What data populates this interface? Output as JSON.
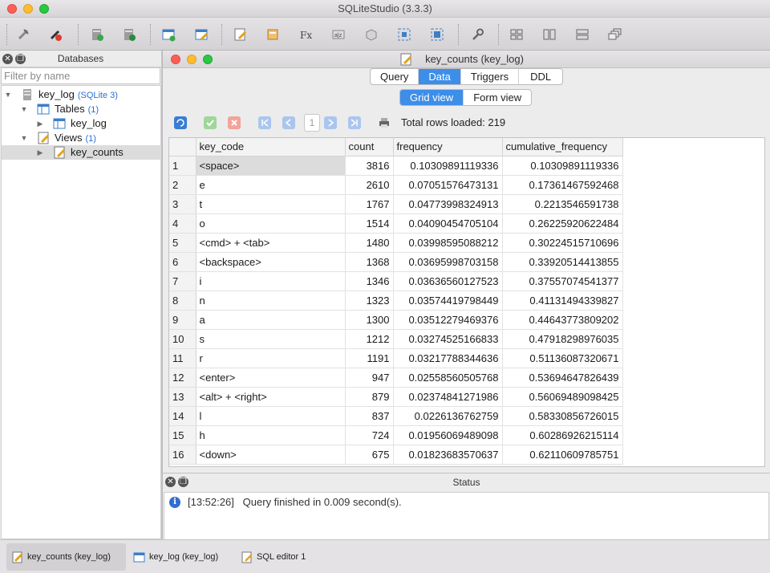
{
  "app": {
    "title": "SQLiteStudio (3.3.3)"
  },
  "toolbar": {
    "buttons": [
      "connect-db",
      "disconnect-db",
      "add-db",
      "edit-db",
      "add-table",
      "edit-table",
      "add-view",
      "add-index",
      "functions",
      "collations",
      "extensions",
      "sql-editor-tiled",
      "sql-editor-cascade",
      "open-sql-editor",
      "config",
      "tile",
      "tile-horizontal",
      "tile-vertical",
      "cascade"
    ]
  },
  "databases_panel": {
    "title": "Databases",
    "filter_placeholder": "Filter by name",
    "tree": {
      "db_name": "key_log",
      "db_type": "(SQLite 3)",
      "tables_label": "Tables",
      "tables_count": "(1)",
      "table_item": "key_log",
      "views_label": "Views",
      "views_count": "(1)",
      "view_item": "key_counts"
    }
  },
  "editor_window": {
    "title": "key_counts (key_log)",
    "tabs": [
      "Query",
      "Data",
      "Triggers",
      "DDL"
    ],
    "active_tab": "Data",
    "view_modes": [
      "Grid view",
      "Form view"
    ],
    "active_view_mode": "Grid view",
    "page": "1",
    "total_rows": "Total rows loaded: 219"
  },
  "grid": {
    "columns": [
      "key_code",
      "count",
      "frequency",
      "cumulative_frequency"
    ],
    "rows": [
      [
        "1",
        "<space>",
        "3816",
        "0.10309891119336",
        "0.10309891119336"
      ],
      [
        "2",
        "e",
        "2610",
        "0.07051576473131",
        "0.17361467592468"
      ],
      [
        "3",
        "t",
        "1767",
        "0.04773998324913",
        "0.2213546591738"
      ],
      [
        "4",
        "o",
        "1514",
        "0.04090454705104",
        "0.26225920622484"
      ],
      [
        "5",
        "<cmd> + <tab>",
        "1480",
        "0.03998595088212",
        "0.30224515710696"
      ],
      [
        "6",
        "<backspace>",
        "1368",
        "0.03695998703158",
        "0.33920514413855"
      ],
      [
        "7",
        "i",
        "1346",
        "0.03636560127523",
        "0.37557074541377"
      ],
      [
        "8",
        "n",
        "1323",
        "0.03574419798449",
        "0.41131494339827"
      ],
      [
        "9",
        "a",
        "1300",
        "0.03512279469376",
        "0.44643773809202"
      ],
      [
        "10",
        "s",
        "1212",
        "0.03274525166833",
        "0.47918298976035"
      ],
      [
        "11",
        "r",
        "1191",
        "0.03217788344636",
        "0.51136087320671"
      ],
      [
        "12",
        "<enter>",
        "947",
        "0.02558560505768",
        "0.53694647826439"
      ],
      [
        "13",
        "<alt> + <right>",
        "879",
        "0.02374841271986",
        "0.56069489098425"
      ],
      [
        "14",
        "l",
        "837",
        "0.0226136762759",
        "0.58330856726015"
      ],
      [
        "15",
        "h",
        "724",
        "0.01956069489098",
        "0.60286926215114"
      ],
      [
        "16",
        "<down>",
        "675",
        "0.01823683570637",
        "0.62110609785751"
      ]
    ]
  },
  "status": {
    "title": "Status",
    "time": "[13:52:26]",
    "message": "Query finished in 0.009 second(s)."
  },
  "taskbar": {
    "items": [
      "key_counts (key_log)",
      "key_log (key_log)",
      "SQL editor 1"
    ]
  },
  "colors": {
    "accent": "#3d8ee8",
    "count_color": "#2a6fd6"
  }
}
